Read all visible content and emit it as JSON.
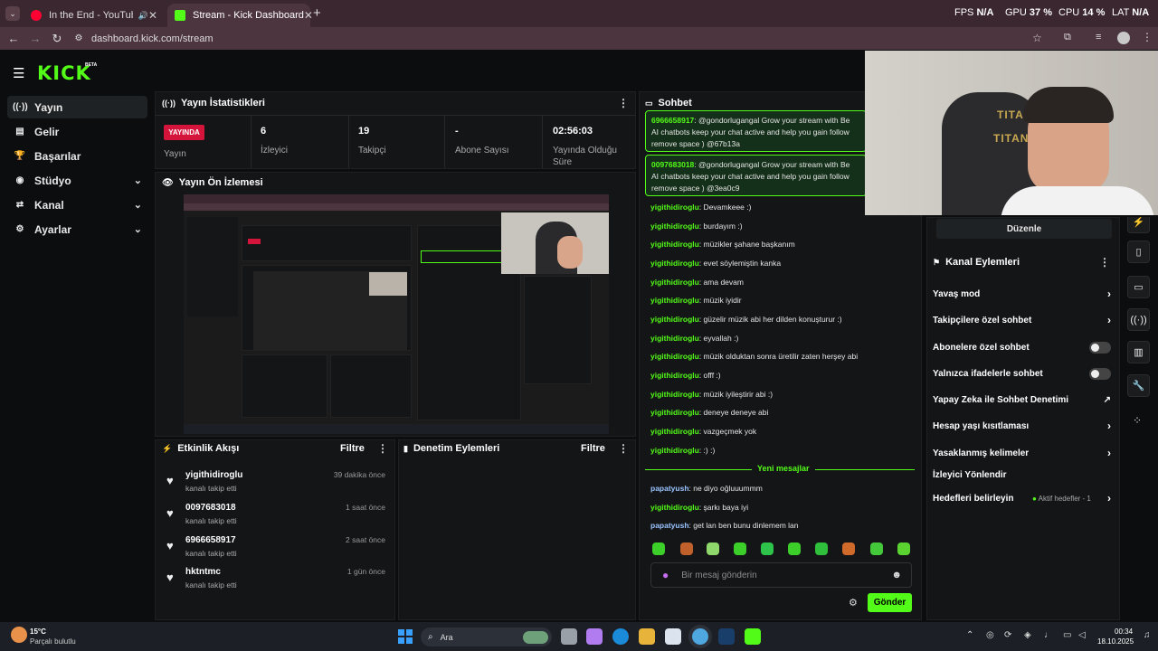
{
  "browser": {
    "tabs": [
      {
        "label": "In the End - YouTube Music",
        "active": false
      },
      {
        "label": "Stream - Kick Dashboard",
        "active": true
      }
    ],
    "url": "dashboard.kick.com/stream",
    "perf": {
      "fps_label": "FPS",
      "fps_value": "N/A",
      "gpu_label": "GPU",
      "gpu_value": "37 %",
      "cpu_label": "CPU",
      "cpu_value": "14 %",
      "lat_label": "LAT",
      "lat_value": "N/A"
    }
  },
  "brand": {
    "logo": "KICK",
    "beta": "BETA",
    "accent": "#53fc18"
  },
  "sidebar": {
    "items": [
      {
        "label": "Yayın",
        "icon": "broadcast-icon",
        "active": true
      },
      {
        "label": "Gelir",
        "icon": "revenue-icon"
      },
      {
        "label": "Başarılar",
        "icon": "trophy-icon"
      },
      {
        "label": "Stüdyo",
        "icon": "studio-icon",
        "expandable": true
      },
      {
        "label": "Kanal",
        "icon": "channel-icon",
        "expandable": true
      },
      {
        "label": "Ayarlar",
        "icon": "gear-icon",
        "expandable": true
      }
    ]
  },
  "stats": {
    "title": "Yayın İstatistikleri",
    "live_badge": "YAYINDA",
    "status_label": "Yayın",
    "viewers": {
      "value": "6",
      "label": "İzleyici"
    },
    "followers": {
      "value": "19",
      "label": "Takipçi"
    },
    "subs": {
      "value": "-",
      "label": "Abone Sayısı"
    },
    "uptime": {
      "value": "02:56:03",
      "label": "Yayında Olduğu Süre"
    }
  },
  "preview": {
    "title": "Yayın Ön İzlemesi"
  },
  "activity": {
    "title": "Etkinlik Akışı",
    "filter": "Filtre",
    "items": [
      {
        "name": "yigithidiroglu",
        "sub": "kanalı takip etti",
        "time": "39 dakika önce"
      },
      {
        "name": "0097683018",
        "sub": "kanalı takip etti",
        "time": "1 saat önce"
      },
      {
        "name": "6966658917",
        "sub": "kanalı takip etti",
        "time": "2 saat önce"
      },
      {
        "name": "hktntmc",
        "sub": "kanalı takip etti",
        "time": "1 gün önce"
      }
    ]
  },
  "moderation": {
    "title": "Denetim Eylemleri",
    "filter": "Filtre"
  },
  "chat": {
    "title": "Sohbet",
    "highlighted": [
      {
        "user": "6966658917",
        "text": ": @gondorlugangal Grow your stream with Be",
        "line2": "AI chatbots keep your chat active and help you gain follow",
        "line3": "remove space ) @67b13a"
      },
      {
        "user": "0097683018",
        "text": ": @gondorlugangal Grow your stream with Be",
        "line2": "AI chatbots keep your chat active and help you gain follow",
        "line3": "remove space ) @3ea0c9"
      }
    ],
    "messages": [
      {
        "user": "yigithidiroglu",
        "text": ": Devamkeee :)"
      },
      {
        "user": "yigithidiroglu",
        "text": ": burdayım :)"
      },
      {
        "user": "yigithidiroglu",
        "text": ": müzikler şahane başkanım"
      },
      {
        "user": "yigithidiroglu",
        "text": ": evet söylemiştin kanka"
      },
      {
        "user": "yigithidiroglu",
        "text": ": ama devam"
      },
      {
        "user": "yigithidiroglu",
        "text": ": müzik iyidir"
      },
      {
        "user": "yigithidiroglu",
        "text": ": güzelir müzik abi her dilden konuşturur :)"
      },
      {
        "user": "yigithidiroglu",
        "text": ": eyvallah :)"
      },
      {
        "user": "yigithidiroglu",
        "text": ": müzik olduktan sonra üretilir zaten herşey abi"
      },
      {
        "user": "yigithidiroglu",
        "text": ": offf :)"
      },
      {
        "user": "yigithidiroglu",
        "text": ": müzik iyileştirir abi :)"
      },
      {
        "user": "yigithidiroglu",
        "text": ": deneye deneye abi"
      },
      {
        "user": "yigithidiroglu",
        "text": ": vazgeçmek yok"
      },
      {
        "user": "yigithidiroglu",
        "text": ": :) :)"
      }
    ],
    "new_messages_label": "Yeni mesajlar",
    "new_messages": [
      {
        "user": "papatyush",
        "text": ": ne diyo oğluuummm"
      },
      {
        "user": "yigithidiroglu",
        "text": ": şarkı baya iyi"
      },
      {
        "user": "papatyush",
        "text": ": get lan ben bunu dinlemem lan"
      }
    ],
    "input_placeholder": "Bir mesaj gönderin",
    "send_label": "Gönder"
  },
  "channel_actions": {
    "edit_label": "Düzenle",
    "title": "Kanal Eylemleri",
    "items": [
      {
        "label": "Yavaş mod",
        "control": "chevron"
      },
      {
        "label": "Takipçilere özel sohbet",
        "control": "chevron"
      },
      {
        "label": "Abonelere özel sohbet",
        "control": "toggle"
      },
      {
        "label": "Yalnızca ifadelerle sohbet",
        "control": "toggle"
      },
      {
        "label": "Yapay Zeka ile Sohbet Denetimi",
        "control": "external"
      },
      {
        "label": "Hesap yaşı kısıtlaması",
        "control": "chevron"
      },
      {
        "label": "Yasaklanmış kelimeler",
        "control": "chevron"
      },
      {
        "label": "İzleyici Yönlendir",
        "control": "none"
      },
      {
        "label": "Hedefleri belirleyin",
        "control": "chevron",
        "badge": "Aktif hedefler - 1"
      }
    ]
  },
  "taskbar": {
    "weather_temp": "15°C",
    "weather_desc": "Parçalı bulutlu",
    "search_label": "Ara",
    "time": "00:34",
    "date": "18.10.2025"
  },
  "webcam": {
    "chair_brand": "TITAN"
  }
}
